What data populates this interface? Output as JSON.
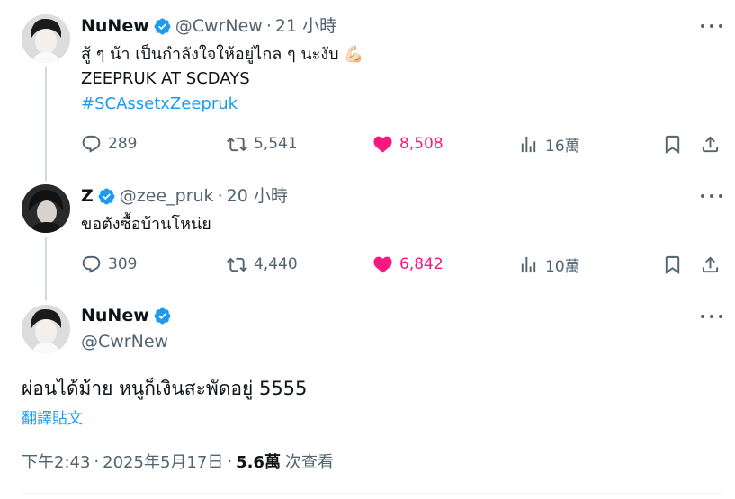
{
  "tweets": [
    {
      "name": "NuNew",
      "handle": "@CwrNew",
      "dot": "·",
      "time": "21 小時",
      "lines": [
        "สู้ ๆ น้า เป็นกำลังใจให้อยู่ไกล ๆ นะงับ",
        "ZEEPRUK AT SCDAYS"
      ],
      "emoji": "💪🏻",
      "hashtag": "#SCAssetxZeepruk",
      "replies": "289",
      "retweets": "5,541",
      "likes": "8,508",
      "views": "16萬"
    },
    {
      "name": "Z",
      "handle": "@zee_pruk",
      "dot": "·",
      "time": "20 小時",
      "lines": [
        "ขอตังซื้อบ้านโหน่ย"
      ],
      "replies": "309",
      "retweets": "4,440",
      "likes": "6,842",
      "views": "10萬"
    }
  ],
  "main": {
    "name": "NuNew",
    "handle": "@CwrNew",
    "text": "ผ่อนได้ม้าย หนูก็เงินสะพัดอยู่ 5555",
    "translate": "翻譯貼文",
    "time": "下午2:43",
    "date": "2025年5月17日",
    "sep": "·",
    "views": "5.6萬",
    "views_label": "次查看"
  },
  "colors": {
    "accent": "#1d9bf0",
    "like": "#f91880",
    "muted": "#536471",
    "text": "#0f1419"
  },
  "icons": [
    "verified-badge-icon",
    "more-icon",
    "reply-icon",
    "retweet-icon",
    "heart-icon",
    "views-icon",
    "bookmark-icon",
    "share-icon"
  ]
}
